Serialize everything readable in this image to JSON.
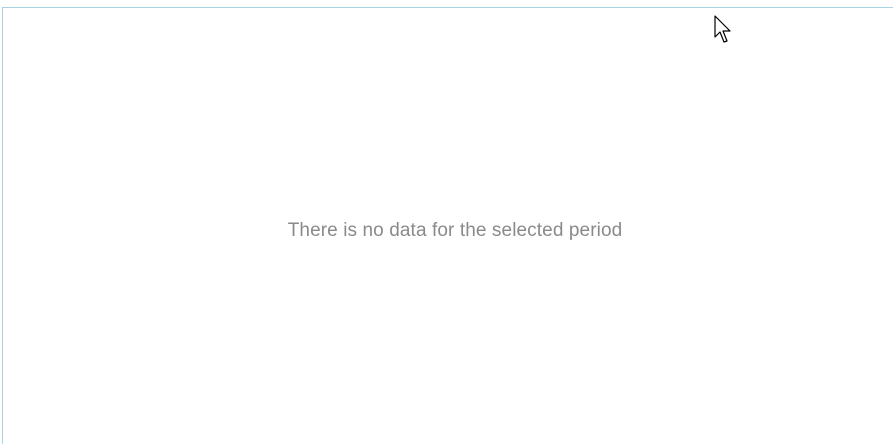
{
  "panel": {
    "empty_message": "There is no data for the selected period"
  },
  "cursor": {
    "icon": "arrow-pointer-icon"
  },
  "colors": {
    "panel_border": "#a8d3e4",
    "message_text": "#8a8a8a",
    "background": "#ffffff"
  }
}
